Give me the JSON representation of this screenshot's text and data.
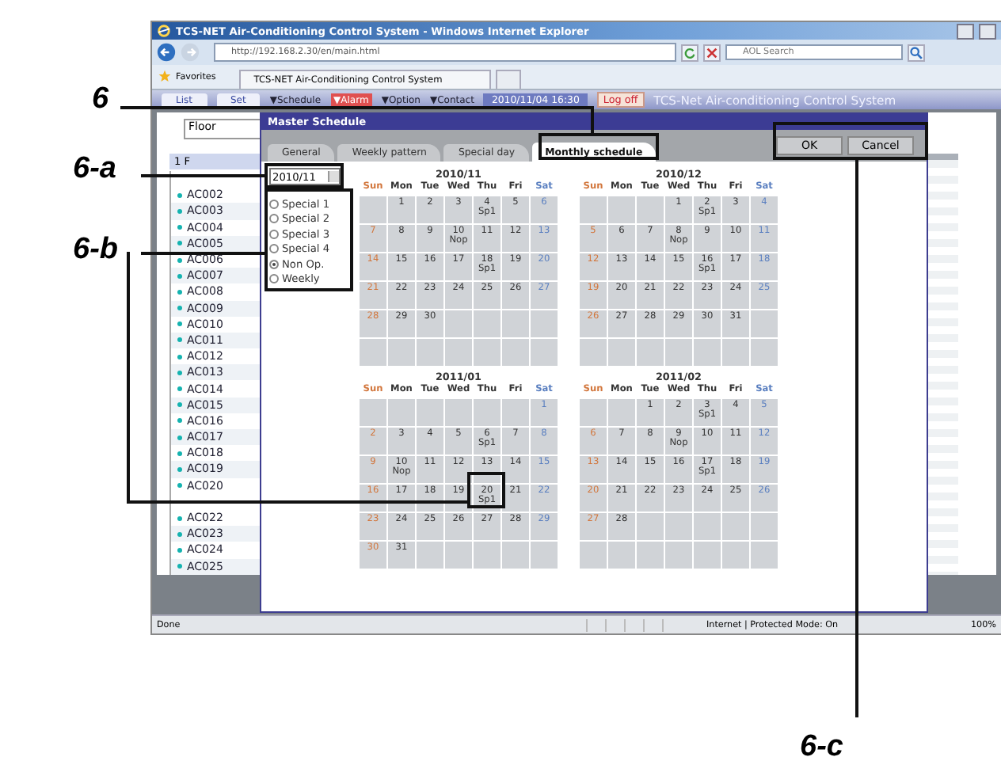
{
  "callouts": [
    {
      "label": "6"
    },
    {
      "label": "6-a"
    },
    {
      "label": "6-b"
    },
    {
      "label": "6-c"
    }
  ],
  "browser": {
    "title": "TCS-NET Air-Conditioning Control System - Windows Internet Explorer",
    "address": "http://192.168.2.30/en/main.html",
    "search_placeholder": "AOL Search",
    "favorites": "Favorites",
    "tab": "TCS-NET Air-Conditioning Control System",
    "status": "Done",
    "zone": "Internet | Protected Mode: On",
    "zoom": "100%"
  },
  "nav": {
    "items": [
      {
        "label": "List",
        "kind": "tab"
      },
      {
        "label": "Set",
        "kind": "tab"
      },
      {
        "label": "▼Schedule",
        "kind": "menu"
      },
      {
        "label": "▼Alarm",
        "kind": "alarm"
      },
      {
        "label": "▼Option",
        "kind": "menu"
      },
      {
        "label": "▼Contact",
        "kind": "menu"
      }
    ],
    "datetime": "2010/11/04 16:30",
    "logoff": "Log off",
    "app_title": "TCS-Net Air-conditioning Control System"
  },
  "sidebar": {
    "floor_field": "Floor",
    "floor": "1 F",
    "units": [
      {
        "kind": "covered"
      },
      {
        "kind": "unit",
        "label": "AC002"
      },
      {
        "kind": "unit",
        "label": "AC003"
      },
      {
        "kind": "unit",
        "label": "AC004"
      },
      {
        "kind": "unit",
        "label": "AC005"
      },
      {
        "kind": "unit",
        "label": "AC006"
      },
      {
        "kind": "unit",
        "label": "AC007"
      },
      {
        "kind": "unit",
        "label": "AC008"
      },
      {
        "kind": "unit",
        "label": "AC009"
      },
      {
        "kind": "unit",
        "label": "AC010"
      },
      {
        "kind": "unit",
        "label": "AC011"
      },
      {
        "kind": "unit",
        "label": "AC012"
      },
      {
        "kind": "unit",
        "label": "AC013"
      },
      {
        "kind": "unit",
        "label": "AC014"
      },
      {
        "kind": "unit",
        "label": "AC015"
      },
      {
        "kind": "unit",
        "label": "AC016"
      },
      {
        "kind": "unit",
        "label": "AC017"
      },
      {
        "kind": "unit",
        "label": "AC018"
      },
      {
        "kind": "unit",
        "label": "AC019"
      },
      {
        "kind": "unit",
        "label": "AC020"
      },
      {
        "kind": "covered"
      },
      {
        "kind": "unit",
        "label": "AC022"
      },
      {
        "kind": "unit",
        "label": "AC023"
      },
      {
        "kind": "unit",
        "label": "AC024"
      },
      {
        "kind": "unit",
        "label": "AC025"
      }
    ]
  },
  "dialog": {
    "title": "Master Schedule",
    "tabs": [
      {
        "label": "General",
        "selected": false
      },
      {
        "label": "Weekly pattern",
        "selected": false
      },
      {
        "label": "Special day",
        "selected": false
      },
      {
        "label": "Monthly schedule",
        "selected": true
      }
    ],
    "buttons": [
      "OK",
      "Cancel"
    ],
    "month_select": "2010/11",
    "options": [
      {
        "label": "Special 1",
        "selected": false
      },
      {
        "label": "Special 2",
        "selected": false
      },
      {
        "label": "Special 3",
        "selected": false
      },
      {
        "label": "Special 4",
        "selected": false
      },
      {
        "label": "Non Op.",
        "selected": true
      },
      {
        "label": "Weekly",
        "selected": false
      }
    ],
    "months": [
      {
        "title": "2010/11",
        "weekdays": [
          "Sun",
          "Mon",
          "Tue",
          "Wed",
          "Thu",
          "Fri",
          "Sat"
        ],
        "weeks": [
          [
            {
              "kind": "blank"
            },
            {
              "kind": "day",
              "day": "1"
            },
            {
              "kind": "day",
              "day": "2"
            },
            {
              "kind": "day",
              "day": "3"
            },
            {
              "kind": "day",
              "day": "4",
              "note": "Sp1"
            },
            {
              "kind": "day",
              "day": "5"
            },
            {
              "kind": "day",
              "day": "6"
            }
          ],
          [
            {
              "kind": "day",
              "day": "7"
            },
            {
              "kind": "day",
              "day": "8"
            },
            {
              "kind": "day",
              "day": "9"
            },
            {
              "kind": "day",
              "day": "10",
              "note": "Nop"
            },
            {
              "kind": "day",
              "day": "11"
            },
            {
              "kind": "day",
              "day": "12"
            },
            {
              "kind": "day",
              "day": "13"
            }
          ],
          [
            {
              "kind": "day",
              "day": "14"
            },
            {
              "kind": "day",
              "day": "15"
            },
            {
              "kind": "day",
              "day": "16"
            },
            {
              "kind": "day",
              "day": "17"
            },
            {
              "kind": "day",
              "day": "18",
              "note": "Sp1"
            },
            {
              "kind": "day",
              "day": "19"
            },
            {
              "kind": "day",
              "day": "20"
            }
          ],
          [
            {
              "kind": "day",
              "day": "21"
            },
            {
              "kind": "day",
              "day": "22"
            },
            {
              "kind": "day",
              "day": "23"
            },
            {
              "kind": "day",
              "day": "24"
            },
            {
              "kind": "day",
              "day": "25"
            },
            {
              "kind": "day",
              "day": "26"
            },
            {
              "kind": "day",
              "day": "27"
            }
          ],
          [
            {
              "kind": "day",
              "day": "28"
            },
            {
              "kind": "day",
              "day": "29"
            },
            {
              "kind": "day",
              "day": "30"
            },
            {
              "kind": "blank"
            },
            {
              "kind": "blank"
            },
            {
              "kind": "blank"
            },
            {
              "kind": "blank"
            }
          ],
          [
            {
              "kind": "blank"
            },
            {
              "kind": "blank"
            },
            {
              "kind": "blank"
            },
            {
              "kind": "blank"
            },
            {
              "kind": "blank"
            },
            {
              "kind": "blank"
            },
            {
              "kind": "blank"
            }
          ]
        ]
      },
      {
        "title": "2010/12",
        "weekdays": [
          "Sun",
          "Mon",
          "Tue",
          "Wed",
          "Thu",
          "Fri",
          "Sat"
        ],
        "weeks": [
          [
            {
              "kind": "blank"
            },
            {
              "kind": "blank"
            },
            {
              "kind": "blank"
            },
            {
              "kind": "day",
              "day": "1"
            },
            {
              "kind": "day",
              "day": "2",
              "note": "Sp1"
            },
            {
              "kind": "day",
              "day": "3"
            },
            {
              "kind": "day",
              "day": "4"
            }
          ],
          [
            {
              "kind": "day",
              "day": "5"
            },
            {
              "kind": "day",
              "day": "6"
            },
            {
              "kind": "day",
              "day": "7"
            },
            {
              "kind": "day",
              "day": "8",
              "note": "Nop"
            },
            {
              "kind": "day",
              "day": "9"
            },
            {
              "kind": "day",
              "day": "10"
            },
            {
              "kind": "day",
              "day": "11"
            }
          ],
          [
            {
              "kind": "day",
              "day": "12"
            },
            {
              "kind": "day",
              "day": "13"
            },
            {
              "kind": "day",
              "day": "14"
            },
            {
              "kind": "day",
              "day": "15"
            },
            {
              "kind": "day",
              "day": "16",
              "note": "Sp1"
            },
            {
              "kind": "day",
              "day": "17"
            },
            {
              "kind": "day",
              "day": "18"
            }
          ],
          [
            {
              "kind": "day",
              "day": "19"
            },
            {
              "kind": "day",
              "day": "20"
            },
            {
              "kind": "day",
              "day": "21"
            },
            {
              "kind": "day",
              "day": "22"
            },
            {
              "kind": "day",
              "day": "23"
            },
            {
              "kind": "day",
              "day": "24"
            },
            {
              "kind": "day",
              "day": "25"
            }
          ],
          [
            {
              "kind": "day",
              "day": "26"
            },
            {
              "kind": "day",
              "day": "27"
            },
            {
              "kind": "day",
              "day": "28"
            },
            {
              "kind": "day",
              "day": "29"
            },
            {
              "kind": "day",
              "day": "30"
            },
            {
              "kind": "day",
              "day": "31"
            },
            {
              "kind": "blank"
            }
          ],
          [
            {
              "kind": "blank"
            },
            {
              "kind": "blank"
            },
            {
              "kind": "blank"
            },
            {
              "kind": "blank"
            },
            {
              "kind": "blank"
            },
            {
              "kind": "blank"
            },
            {
              "kind": "blank"
            }
          ]
        ]
      },
      {
        "title": "2011/01",
        "weekdays": [
          "Sun",
          "Mon",
          "Tue",
          "Wed",
          "Thu",
          "Fri",
          "Sat"
        ],
        "weeks": [
          [
            {
              "kind": "blank"
            },
            {
              "kind": "blank"
            },
            {
              "kind": "blank"
            },
            {
              "kind": "blank"
            },
            {
              "kind": "blank"
            },
            {
              "kind": "blank"
            },
            {
              "kind": "day",
              "day": "1"
            }
          ],
          [
            {
              "kind": "day",
              "day": "2"
            },
            {
              "kind": "day",
              "day": "3"
            },
            {
              "kind": "day",
              "day": "4"
            },
            {
              "kind": "day",
              "day": "5"
            },
            {
              "kind": "day",
              "day": "6",
              "note": "Sp1"
            },
            {
              "kind": "day",
              "day": "7"
            },
            {
              "kind": "day",
              "day": "8"
            }
          ],
          [
            {
              "kind": "day",
              "day": "9"
            },
            {
              "kind": "day",
              "day": "10",
              "note": "Nop"
            },
            {
              "kind": "day",
              "day": "11"
            },
            {
              "kind": "day",
              "day": "12"
            },
            {
              "kind": "day",
              "day": "13"
            },
            {
              "kind": "day",
              "day": "14"
            },
            {
              "kind": "day",
              "day": "15"
            }
          ],
          [
            {
              "kind": "day",
              "day": "16"
            },
            {
              "kind": "day",
              "day": "17"
            },
            {
              "kind": "day",
              "day": "18"
            },
            {
              "kind": "day",
              "day": "19"
            },
            {
              "kind": "day",
              "day": "20",
              "note": "Sp1"
            },
            {
              "kind": "day",
              "day": "21"
            },
            {
              "kind": "day",
              "day": "22"
            }
          ],
          [
            {
              "kind": "day",
              "day": "23"
            },
            {
              "kind": "day",
              "day": "24"
            },
            {
              "kind": "day",
              "day": "25"
            },
            {
              "kind": "day",
              "day": "26"
            },
            {
              "kind": "day",
              "day": "27"
            },
            {
              "kind": "day",
              "day": "28"
            },
            {
              "kind": "day",
              "day": "29"
            }
          ],
          [
            {
              "kind": "day",
              "day": "30"
            },
            {
              "kind": "day",
              "day": "31"
            },
            {
              "kind": "blank"
            },
            {
              "kind": "blank"
            },
            {
              "kind": "blank"
            },
            {
              "kind": "blank"
            },
            {
              "kind": "blank"
            }
          ]
        ]
      },
      {
        "title": "2011/02",
        "weekdays": [
          "Sun",
          "Mon",
          "Tue",
          "Wed",
          "Thu",
          "Fri",
          "Sat"
        ],
        "weeks": [
          [
            {
              "kind": "blank"
            },
            {
              "kind": "blank"
            },
            {
              "kind": "day",
              "day": "1"
            },
            {
              "kind": "day",
              "day": "2"
            },
            {
              "kind": "day",
              "day": "3",
              "note": "Sp1"
            },
            {
              "kind": "day",
              "day": "4"
            },
            {
              "kind": "day",
              "day": "5"
            }
          ],
          [
            {
              "kind": "day",
              "day": "6"
            },
            {
              "kind": "day",
              "day": "7"
            },
            {
              "kind": "day",
              "day": "8"
            },
            {
              "kind": "day",
              "day": "9",
              "note": "Nop"
            },
            {
              "kind": "day",
              "day": "10"
            },
            {
              "kind": "day",
              "day": "11"
            },
            {
              "kind": "day",
              "day": "12"
            }
          ],
          [
            {
              "kind": "day",
              "day": "13"
            },
            {
              "kind": "day",
              "day": "14"
            },
            {
              "kind": "day",
              "day": "15"
            },
            {
              "kind": "day",
              "day": "16"
            },
            {
              "kind": "day",
              "day": "17",
              "note": "Sp1"
            },
            {
              "kind": "day",
              "day": "18"
            },
            {
              "kind": "day",
              "day": "19"
            }
          ],
          [
            {
              "kind": "day",
              "day": "20"
            },
            {
              "kind": "day",
              "day": "21"
            },
            {
              "kind": "day",
              "day": "22"
            },
            {
              "kind": "day",
              "day": "23"
            },
            {
              "kind": "day",
              "day": "24"
            },
            {
              "kind": "day",
              "day": "25"
            },
            {
              "kind": "day",
              "day": "26"
            }
          ],
          [
            {
              "kind": "day",
              "day": "27"
            },
            {
              "kind": "day",
              "day": "28"
            },
            {
              "kind": "blank"
            },
            {
              "kind": "blank"
            },
            {
              "kind": "blank"
            },
            {
              "kind": "blank"
            },
            {
              "kind": "blank"
            }
          ],
          [
            {
              "kind": "blank"
            },
            {
              "kind": "blank"
            },
            {
              "kind": "blank"
            },
            {
              "kind": "blank"
            },
            {
              "kind": "blank"
            },
            {
              "kind": "blank"
            },
            {
              "kind": "blank"
            }
          ]
        ]
      }
    ]
  }
}
